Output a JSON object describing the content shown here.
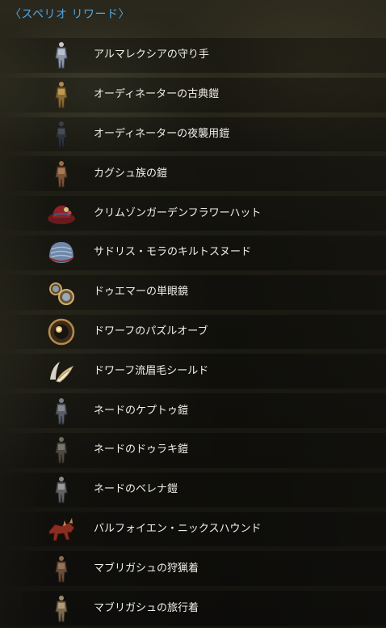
{
  "header": {
    "title": "〈スペリオ リワード〉"
  },
  "rewards": [
    {
      "label": "アルマレクシアの守り手",
      "icon": "armor-figure-icon"
    },
    {
      "label": "オーディネーターの古典鎧",
      "icon": "armor-figure-icon"
    },
    {
      "label": "オーディネーターの夜襲用鎧",
      "icon": "armor-figure-icon"
    },
    {
      "label": "カグシュ族の鎧",
      "icon": "armor-figure-icon"
    },
    {
      "label": "クリムゾンガーデンフラワーハット",
      "icon": "hat-icon"
    },
    {
      "label": "サドリス・モラのキルトスヌード",
      "icon": "snood-icon"
    },
    {
      "label": "ドゥエマーの単眼鏡",
      "icon": "monocle-icon"
    },
    {
      "label": "ドワーフのパズルオーブ",
      "icon": "orb-icon"
    },
    {
      "label": "ドワーフ流眉毛シールド",
      "icon": "brow-shield-icon"
    },
    {
      "label": "ネードのケプトゥ鎧",
      "icon": "armor-figure-icon"
    },
    {
      "label": "ネードのドゥラキ鎧",
      "icon": "armor-figure-icon"
    },
    {
      "label": "ネードのベレナ鎧",
      "icon": "armor-figure-icon"
    },
    {
      "label": "バルフォイエン・ニックスハウンド",
      "icon": "nixhound-icon"
    },
    {
      "label": "マブリガシュの狩猟着",
      "icon": "armor-figure-icon"
    },
    {
      "label": "マブリガシュの旅行着",
      "icon": "armor-figure-icon"
    }
  ]
}
